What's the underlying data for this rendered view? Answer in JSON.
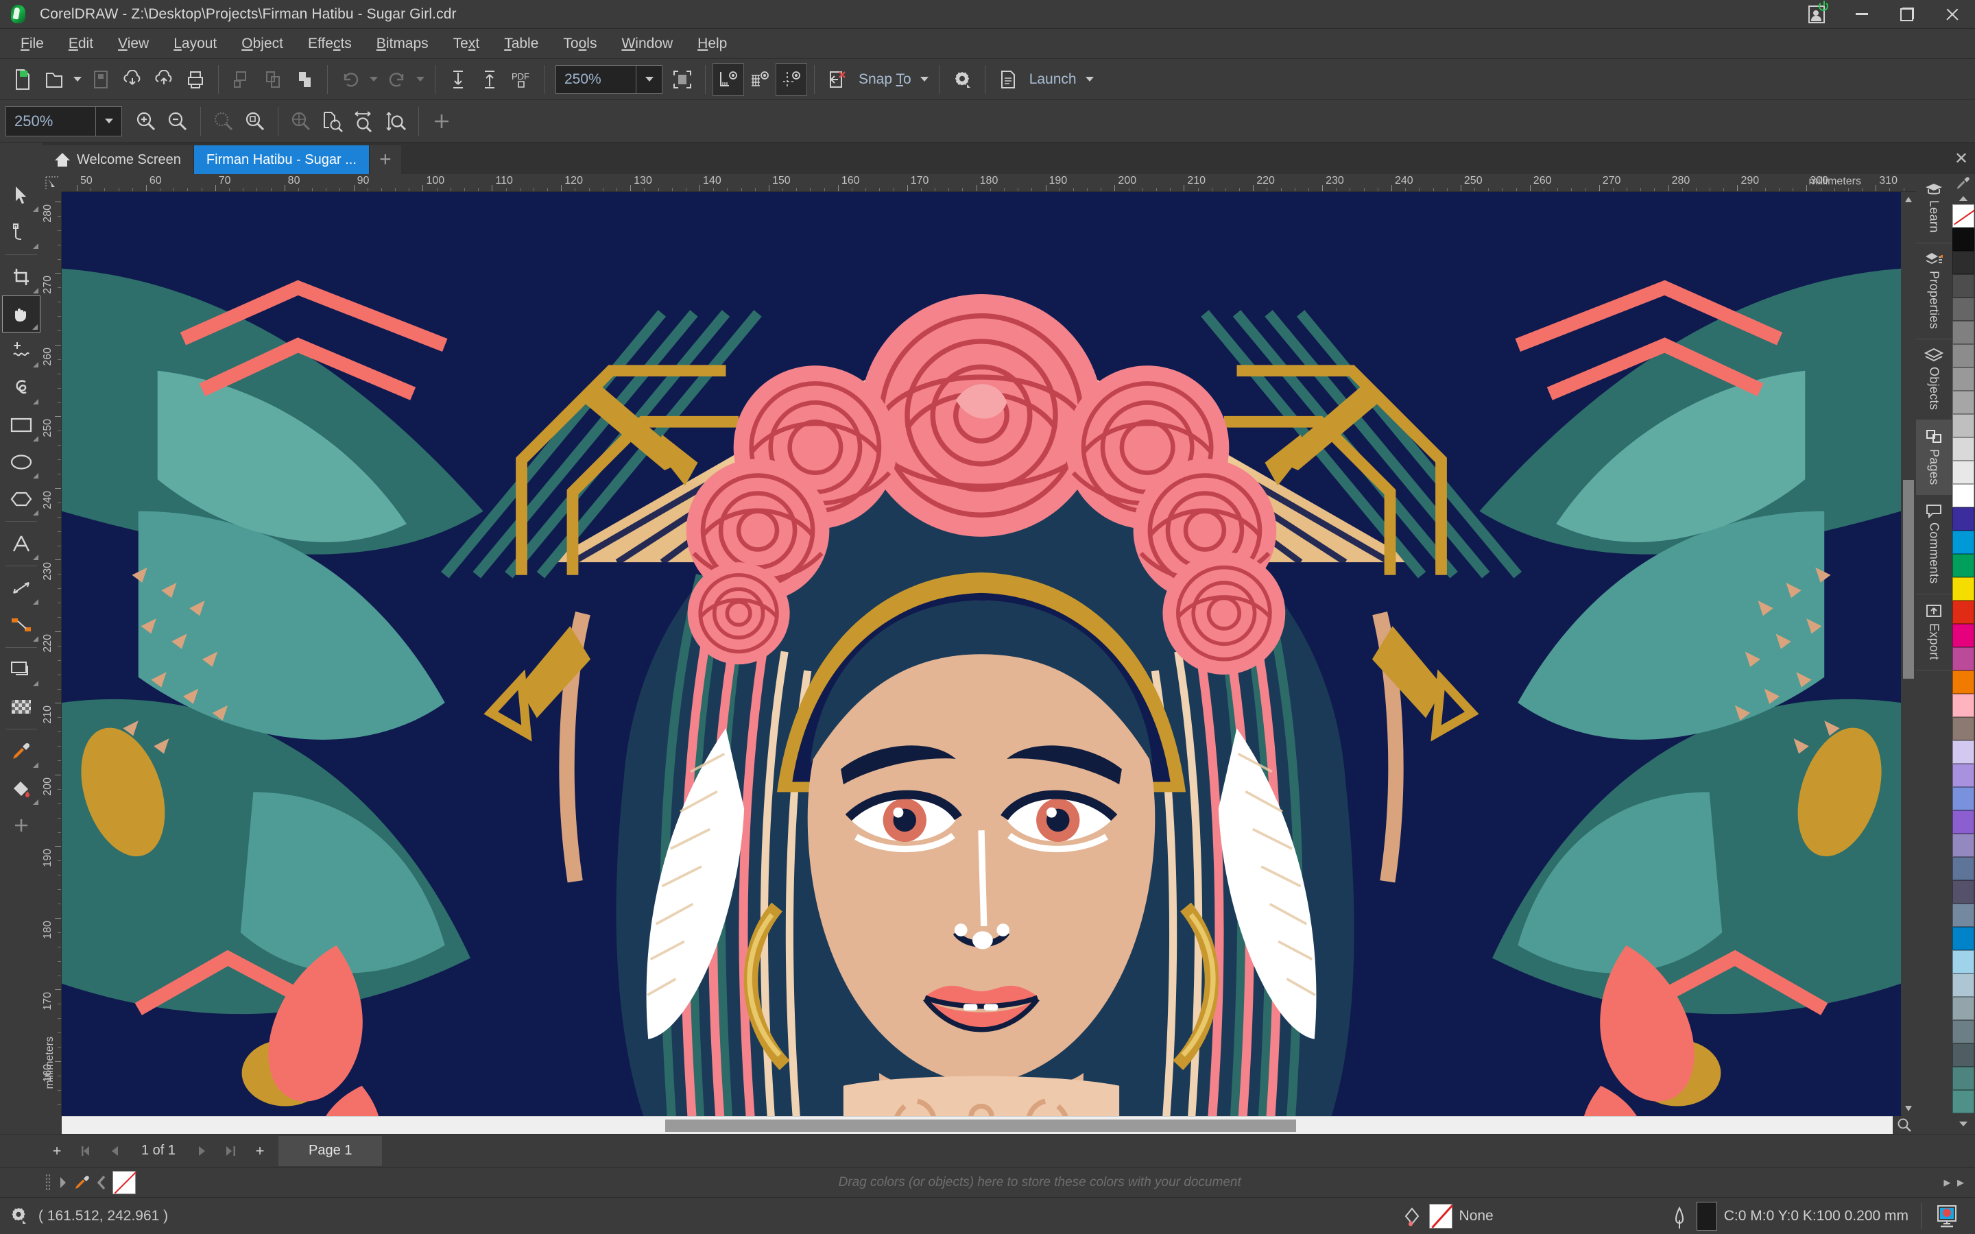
{
  "window": {
    "title": "CorelDRAW - Z:\\Desktop\\Projects\\Firman Hatibu -  Sugar Girl.cdr",
    "logo_icon": "coreldraw-balloon-icon",
    "controls": {
      "account_icon": "account-signin-icon",
      "minimize_icon": "minimize-icon",
      "restore_icon": "restore-icon",
      "close_icon": "close-icon"
    }
  },
  "menubar": {
    "items": [
      {
        "label": "File",
        "accel": "F"
      },
      {
        "label": "Edit",
        "accel": "E"
      },
      {
        "label": "View",
        "accel": "V"
      },
      {
        "label": "Layout",
        "accel": "L"
      },
      {
        "label": "Object",
        "accel": "O"
      },
      {
        "label": "Effects",
        "accel": "c"
      },
      {
        "label": "Bitmaps",
        "accel": "B"
      },
      {
        "label": "Text",
        "accel": "x"
      },
      {
        "label": "Table",
        "accel": "T"
      },
      {
        "label": "Tools",
        "accel": "o"
      },
      {
        "label": "Window",
        "accel": "W"
      },
      {
        "label": "Help",
        "accel": "H"
      }
    ]
  },
  "standard_toolbar": {
    "buttons": [
      {
        "name": "new-document-button",
        "icon": "new-document-icon",
        "enabled": true
      },
      {
        "name": "open-document-button",
        "icon": "open-folder-icon",
        "enabled": true
      },
      {
        "name": "save-document-button",
        "icon": "save-disk-icon",
        "enabled": false
      },
      {
        "name": "publish-to-cloud-button",
        "icon": "cloud-download-icon",
        "enabled": true
      },
      {
        "name": "share-document-button",
        "icon": "cloud-upload-icon",
        "enabled": true
      },
      {
        "name": "print-button",
        "icon": "printer-icon",
        "enabled": true
      },
      {
        "name": "cut-button",
        "icon": "cut-icon",
        "enabled": false
      },
      {
        "name": "copy-button",
        "icon": "copy-icon",
        "enabled": false
      },
      {
        "name": "paste-button",
        "icon": "paste-icon",
        "enabled": true
      },
      {
        "name": "undo-button",
        "icon": "undo-arrow-icon",
        "enabled": false
      },
      {
        "name": "redo-button",
        "icon": "redo-arrow-icon",
        "enabled": false
      },
      {
        "name": "import-button",
        "icon": "import-arrow-down-icon",
        "enabled": true
      },
      {
        "name": "export-button",
        "icon": "export-arrow-up-icon",
        "enabled": true
      },
      {
        "name": "export-pdf-button",
        "icon": "pdf-export-icon",
        "enabled": true
      }
    ],
    "zoom_level": "250%",
    "fullscreen_icon": "full-screen-preview-icon",
    "view_toggles": [
      {
        "name": "show-rulers-toggle",
        "icon": "ruler-eye-icon",
        "active": true
      },
      {
        "name": "show-grid-toggle",
        "icon": "grid-eye-icon",
        "active": false
      },
      {
        "name": "show-guidelines-toggle",
        "icon": "guideline-eye-icon",
        "active": true
      }
    ],
    "snap_off_icon": "snap-off-icon",
    "snap_label": "Snap To",
    "snap_accel": "T",
    "options_icon": "options-gear-icon",
    "launch_icon": "launch-app-icon",
    "launch_label": "Launch"
  },
  "property_bar": {
    "zoom_level": "250%",
    "buttons": [
      {
        "name": "zoom-in-button",
        "icon": "zoom-in-magnifier-icon",
        "enabled": true
      },
      {
        "name": "zoom-out-button",
        "icon": "zoom-out-magnifier-icon",
        "enabled": true
      },
      {
        "name": "zoom-to-selected-button",
        "icon": "zoom-selection-icon",
        "enabled": false
      },
      {
        "name": "zoom-to-all-objects-button",
        "icon": "zoom-all-objects-icon",
        "enabled": true
      },
      {
        "name": "zoom-to-all-pages-button",
        "icon": "zoom-all-pages-icon",
        "enabled": false
      },
      {
        "name": "zoom-to-page-button",
        "icon": "zoom-page-icon",
        "enabled": true
      },
      {
        "name": "zoom-to-page-width-button",
        "icon": "zoom-page-width-icon",
        "enabled": true
      },
      {
        "name": "zoom-to-page-height-button",
        "icon": "zoom-page-height-icon",
        "enabled": true
      },
      {
        "name": "customize-toolbar-button",
        "icon": "plus-icon",
        "enabled": true
      }
    ]
  },
  "toolbox": {
    "tools": [
      {
        "name": "pick-tool",
        "icon": "arrow-cursor-icon",
        "active": false,
        "flyout": true
      },
      {
        "name": "shape-tool",
        "icon": "node-edit-icon",
        "active": false,
        "flyout": true
      },
      {
        "name": "crop-tool",
        "icon": "crop-icon",
        "active": false,
        "flyout": true
      },
      {
        "name": "pan-tool",
        "icon": "hand-pan-icon",
        "active": true,
        "flyout": true
      },
      {
        "name": "freehand-tool",
        "icon": "freehand-curve-icon",
        "active": false,
        "flyout": true
      },
      {
        "name": "smart-fill-tool",
        "icon": "smart-drawing-icon",
        "active": false,
        "flyout": true
      },
      {
        "name": "rectangle-tool",
        "icon": "rectangle-icon",
        "active": false,
        "flyout": true
      },
      {
        "name": "ellipse-tool",
        "icon": "ellipse-icon",
        "active": false,
        "flyout": true
      },
      {
        "name": "polygon-tool",
        "icon": "polygon-icon",
        "active": false,
        "flyout": true
      },
      {
        "name": "text-tool",
        "icon": "text-a-icon",
        "active": false,
        "flyout": true
      },
      {
        "name": "parallel-dimension-tool",
        "icon": "dimension-line-icon",
        "active": false,
        "flyout": true
      },
      {
        "name": "connector-tool",
        "icon": "connector-line-icon",
        "active": false,
        "flyout": true
      },
      {
        "name": "drop-shadow-tool",
        "icon": "drop-shadow-icon",
        "active": false,
        "flyout": true
      },
      {
        "name": "transparency-tool",
        "icon": "transparency-checker-icon",
        "active": false,
        "flyout": false
      },
      {
        "name": "color-eyedropper-tool",
        "icon": "eyedropper-icon",
        "active": false,
        "flyout": true
      },
      {
        "name": "interactive-fill-tool",
        "icon": "fill-bucket-icon",
        "active": false,
        "flyout": true
      },
      {
        "name": "add-tool-button",
        "icon": "plus-icon",
        "active": false,
        "flyout": false
      }
    ]
  },
  "tabs": {
    "items": [
      {
        "label": "Welcome Screen",
        "icon": "home-icon",
        "active": false
      },
      {
        "label": "Firman Hatibu -  Sugar ...",
        "icon": "",
        "active": true
      }
    ],
    "add_tab_icon": "plus-icon",
    "close_icon": "close-icon"
  },
  "rulers": {
    "unit": "millimeters",
    "horizontal_ticks": [
      50,
      60,
      70,
      80,
      90,
      100,
      110,
      120,
      130,
      140,
      150,
      160,
      170,
      180,
      190,
      200,
      210,
      220,
      230,
      240,
      250,
      260,
      270,
      280,
      290,
      300,
      310
    ],
    "vertical_ticks": [
      280,
      270,
      260,
      250,
      240,
      230,
      220,
      210,
      200,
      190,
      180,
      170,
      160
    ]
  },
  "page_nav": {
    "add_page_icon": "plus-icon",
    "first_icon": "first-page-icon",
    "prev_icon": "previous-page-icon",
    "counter": "1  of  1",
    "next_icon": "next-page-icon",
    "last_icon": "last-page-icon",
    "add_after_icon": "plus-icon",
    "page_tab_label": "Page 1"
  },
  "document_palette": {
    "handle_icon": "drag-handle-icon",
    "scroll_icon": "scroll-right-icon",
    "eyedropper_icon": "eyedropper-icon",
    "back_icon": "scroll-left-icon",
    "none_swatch": "no-color-swatch",
    "hint": "Drag colors (or objects) here to store these colors with your document",
    "more_icon": "more-swatches-icon"
  },
  "statusbar": {
    "gear_icon": "status-gear-icon",
    "cursor_position": "( 161.512, 242.961 )",
    "fill_icon": "fill-color-icon",
    "fill_value": "None",
    "outline_icon": "outline-pen-icon",
    "outline_value": "C:0 M:0 Y:0 K:100  0.200 mm",
    "outline_color": "#1b1b1b",
    "monitor_icon": "document-color-preview-icon"
  },
  "dock": {
    "items": [
      {
        "label": "Learn",
        "icon": "graduation-cap-icon",
        "active": false
      },
      {
        "label": "Properties",
        "icon": "properties-layers-icon",
        "active": false
      },
      {
        "label": "Objects",
        "icon": "objects-stack-icon",
        "active": false
      },
      {
        "label": "Pages",
        "icon": "pages-icon",
        "active": true
      },
      {
        "label": "Comments",
        "icon": "comment-bubble-icon",
        "active": false
      },
      {
        "label": "Export",
        "icon": "export-box-icon",
        "active": false
      }
    ]
  },
  "color_palette": {
    "up_icon": "palette-scroll-up-icon",
    "down_icon": "palette-scroll-down-icon",
    "expand_icon": "palette-expand-icon",
    "swatches": [
      "#FFFFFF",
      "#0D0D0D",
      "#2D2D2D",
      "#4D4D4D",
      "#666666",
      "#808080",
      "#8C8C8C",
      "#999999",
      "#A6A6A6",
      "#BFBFBF",
      "#D9D9D9",
      "#E8E8E8",
      "#FFFFFF",
      "#3B2D9E",
      "#0099D8",
      "#00A05C",
      "#F5DD00",
      "#E02B15",
      "#E5007E",
      "#BC4A9B",
      "#F07B00",
      "#FFB3BF",
      "#8C7A72",
      "#D3C9F0",
      "#A892E0",
      "#7A92DD",
      "#8B5FD0",
      "#9488C0",
      "#5F7499",
      "#55516B",
      "#7489A0",
      "#0083C9",
      "#9FD3EC",
      "#AEC6D3",
      "#93A5AB",
      "#6C7E86",
      "#4E5E63",
      "#4E8480",
      "#4F9189"
    ]
  },
  "artwork": {
    "name": "sugar-girl-vector-illustration",
    "palette": {
      "navy": "#0F1A4E",
      "navy_deep": "#131B52",
      "coral": "#F4716A",
      "pink": "#F4838C",
      "rose": "#F07882",
      "teal": "#2E6E6B",
      "teal_light": "#4E9C95",
      "teal_pale": "#63AFA6",
      "gold": "#C8982E",
      "gold_light": "#E0B54A",
      "cream": "#F6D9AE",
      "skin": "#E3B595",
      "skin_light": "#EFC9AC",
      "white": "#FFFFFF"
    }
  },
  "accent_color": "#1b82d8"
}
